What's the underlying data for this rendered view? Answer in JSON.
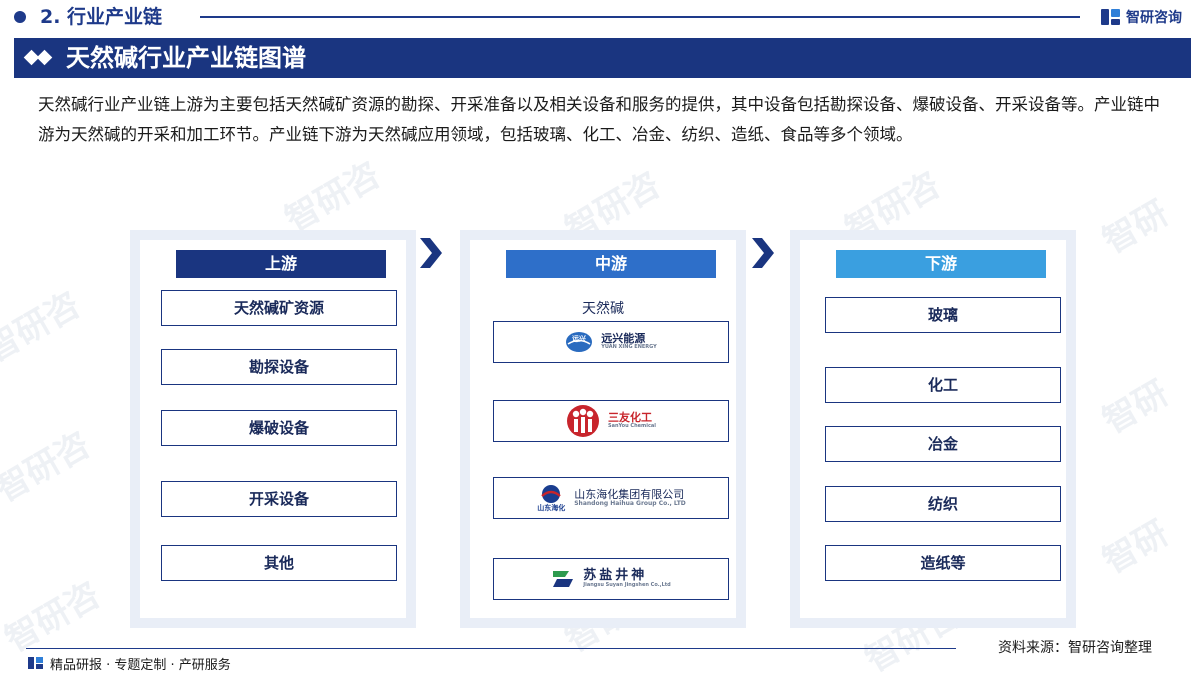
{
  "header": {
    "section_label": "2. 行业产业链",
    "brand": "智研咨询"
  },
  "banner": {
    "title": "天然碱行业产业链图谱"
  },
  "intro": "天然碱行业产业链上游为主要包括天然碱矿资源的勘探、开采准备以及相关设备和服务的提供，其中设备包括勘探设备、爆破设备、开采设备等。产业链中游为天然碱的开采和加工环节。产业链下游为天然碱应用领域，包括玻璃、化工、冶金、纺织、造纸、食品等多个领域。",
  "upstream": {
    "title": "上游",
    "items": [
      "天然碱矿资源",
      "勘探设备",
      "爆破设备",
      "开采设备",
      "其他"
    ]
  },
  "midstream": {
    "title": "中游",
    "subtitle": "天然碱",
    "companies": [
      {
        "name": "远兴能源",
        "en": "YUAN XING ENERGY",
        "logo_text": "远兴",
        "logo_color": "#2a6bbf"
      },
      {
        "name": "三友化工",
        "en": "SanYou Chemical",
        "logo_text": "",
        "logo_color": "#c8252c"
      },
      {
        "name": "山东海化集团有限公司",
        "en": "Shandong Haihua Group Co., LTD",
        "logo_text": "山东海化",
        "logo_color": "#1a3d8f"
      },
      {
        "name": "苏盐井神",
        "en": "Jiangsu Suyan Jingshen Co.,Ltd",
        "logo_text": "",
        "logo_color": "#2e9b4f"
      }
    ]
  },
  "downstream": {
    "title": "下游",
    "items": [
      "玻璃",
      "化工",
      "冶金",
      "纺织",
      "造纸等"
    ]
  },
  "footer": {
    "source": "资料来源：智研咨询整理",
    "tagline": "精品研报 · 专题定制 · 产研服务"
  },
  "watermark": "智研咨询",
  "colors": {
    "navy": "#1a3580",
    "mid_blue": "#2e6fc9",
    "light_blue": "#3a9fe0",
    "panel_bg": "#e9eef7"
  }
}
